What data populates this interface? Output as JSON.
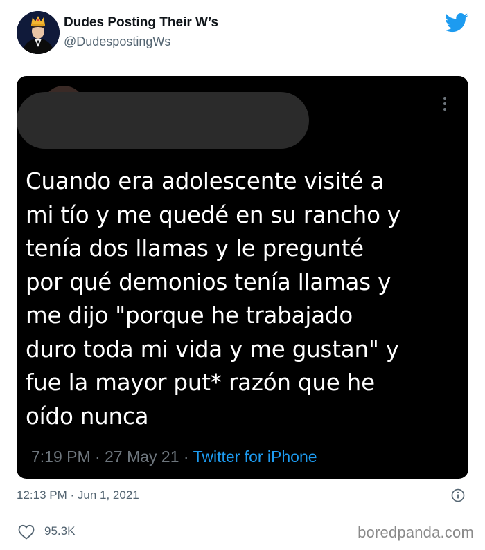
{
  "author": {
    "name": "Dudes Posting Their W’s",
    "handle": "@DudespostingWs",
    "avatar_icon": "crowned-profile-avatar"
  },
  "brand_icon": "twitter-bird-icon",
  "colors": {
    "twitter_blue": "#1d9bf0",
    "card_background": "#000000",
    "meta_gray": "#6e767d",
    "redaction_gray": "#2b2b2b"
  },
  "embedded_tweet": {
    "text": "Cuando era adolescente visité a\nmi tío y me quedé en su rancho y\ntenía dos llamas y le pregunté\npor qué demonios tenía llamas y\nme dijo \"porque he trabajado\nduro toda mi vida y me gustan\" y\nfue la mayor put* razón que he\noído nunca",
    "time": "7:19 PM",
    "date": "27 May 21",
    "separator": "·",
    "source": "Twitter for iPhone"
  },
  "timestamp": "12:13 PM · Jun 1, 2021",
  "likes": "95.3K",
  "watermark": "boredpanda.com"
}
